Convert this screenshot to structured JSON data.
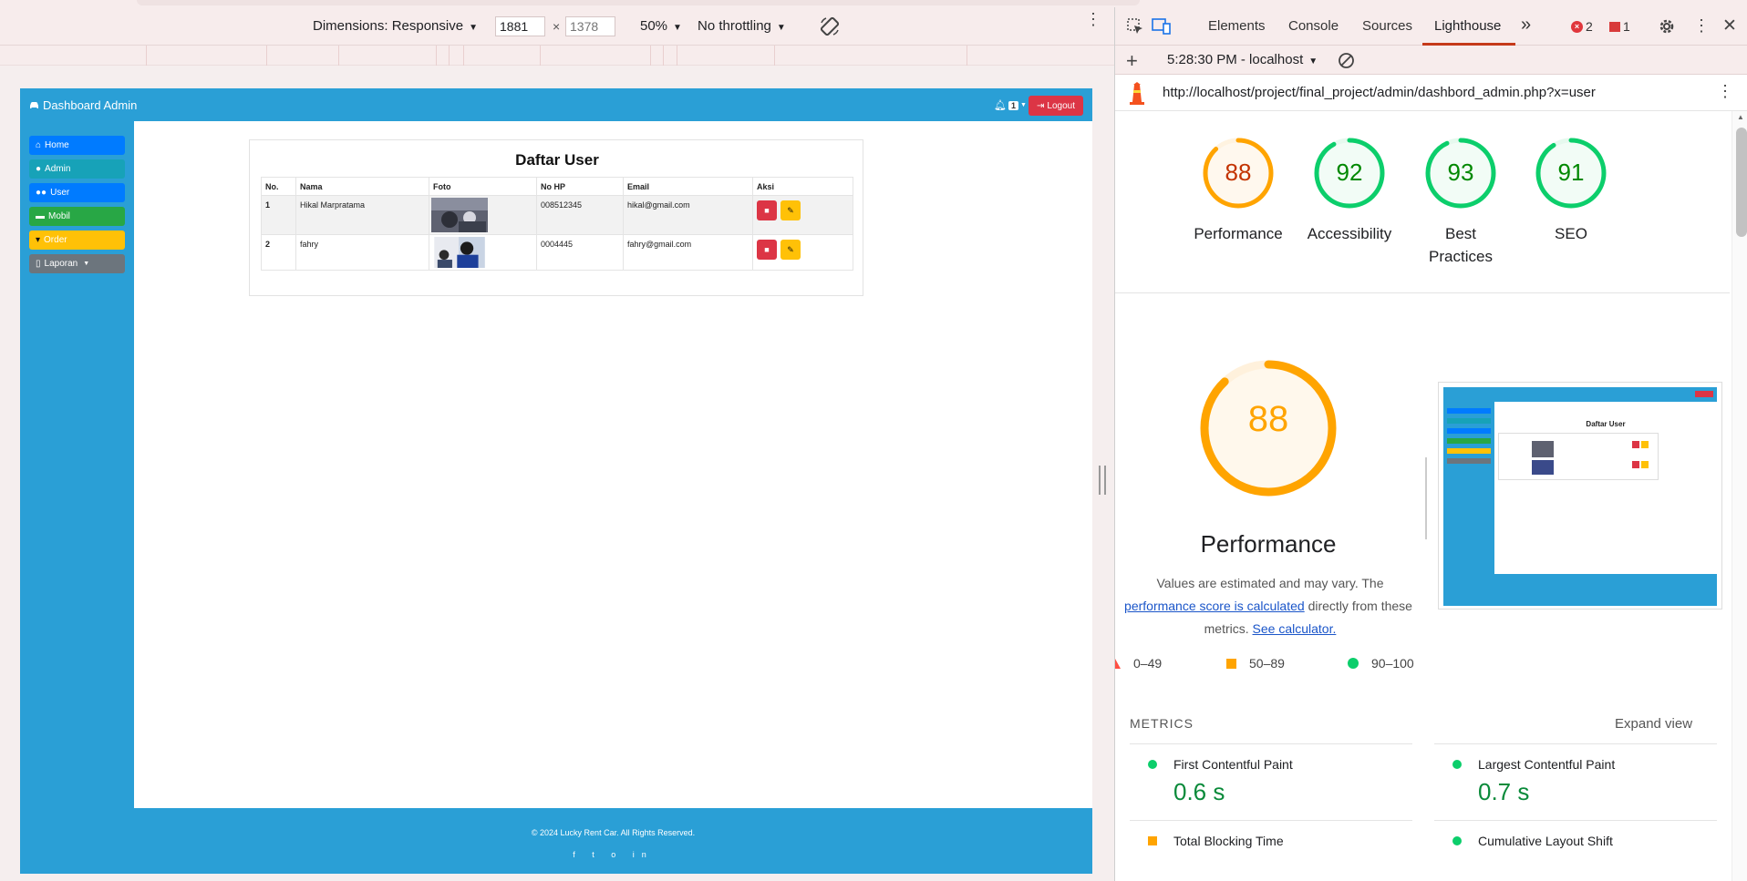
{
  "device_toolbar": {
    "dimensions_label": "Dimensions: Responsive",
    "width": "1881",
    "height_placeholder": "1378",
    "times": "×",
    "zoom": "50%",
    "throttling": "No throttling"
  },
  "emulated_page": {
    "brand": "Dashboard Admin",
    "notif_count": "1",
    "logout": "Logout",
    "sidebar": [
      {
        "label": "Home",
        "icon": "home-icon",
        "color": "#007bff"
      },
      {
        "label": "Admin",
        "icon": "user-icon",
        "color": "#17a2b8"
      },
      {
        "label": "User",
        "icon": "users-icon",
        "color": "#007bff"
      },
      {
        "label": "Mobil",
        "icon": "car-icon",
        "color": "#28a745"
      },
      {
        "label": "Order",
        "icon": "cart-icon",
        "color": "#ffc107"
      },
      {
        "label": "Laporan",
        "icon": "file-icon",
        "color": "#6c757d"
      }
    ],
    "table_title": "Daftar User",
    "columns": [
      "No.",
      "Nama",
      "Foto",
      "No HP",
      "Email",
      "Aksi"
    ],
    "rows": [
      {
        "no": "1",
        "nama": "Hikal Marpratama",
        "hp": "008512345",
        "email": "hikal@gmail.com"
      },
      {
        "no": "2",
        "nama": "fahry",
        "hp": "0004445",
        "email": "fahry@gmail.com"
      }
    ],
    "footer": "© 2024 Lucky Rent Car. All Rights Reserved.",
    "social_icons": [
      "f",
      "t",
      "o",
      "in"
    ]
  },
  "devtools": {
    "tabs": [
      "Elements",
      "Console",
      "Sources",
      "Lighthouse"
    ],
    "active_tab": "Lighthouse",
    "more_tabs": "»",
    "errors": "2",
    "warnings": "1",
    "report_time": "5:28:30 PM - localhost",
    "url": "http://localhost/project/final_project/admin/dashbord_admin.php?x=user",
    "scores": [
      {
        "label": "Performance",
        "value": "88",
        "color": "#ffa400",
        "text_color": "#c33300"
      },
      {
        "label": "Accessibility",
        "value": "92",
        "color": "#0cce6b",
        "text_color": "#008800"
      },
      {
        "label": "Best Practices",
        "value": "93",
        "color": "#0cce6b",
        "text_color": "#008800"
      },
      {
        "label": "SEO",
        "value": "91",
        "color": "#0cce6b",
        "text_color": "#008800"
      }
    ],
    "perf_big_score": "88",
    "perf_heading": "Performance",
    "perf_desc_1": "Values are estimated and may vary. The",
    "perf_link_1": "performance score is calculated",
    "perf_desc_2": "directly from these",
    "perf_desc_3": "metrics.",
    "perf_link_2": "See calculator.",
    "legend": [
      "0–49",
      "50–89",
      "90–100"
    ],
    "metrics_heading": "METRICS",
    "expand_view": "Expand view",
    "metrics": [
      {
        "name": "First Contentful Paint",
        "value": "0.6 s"
      },
      {
        "name": "Largest Contentful Paint",
        "value": "0.7 s"
      },
      {
        "name": "Total Blocking Time",
        "value": ""
      },
      {
        "name": "Cumulative Layout Shift",
        "value": ""
      }
    ]
  }
}
